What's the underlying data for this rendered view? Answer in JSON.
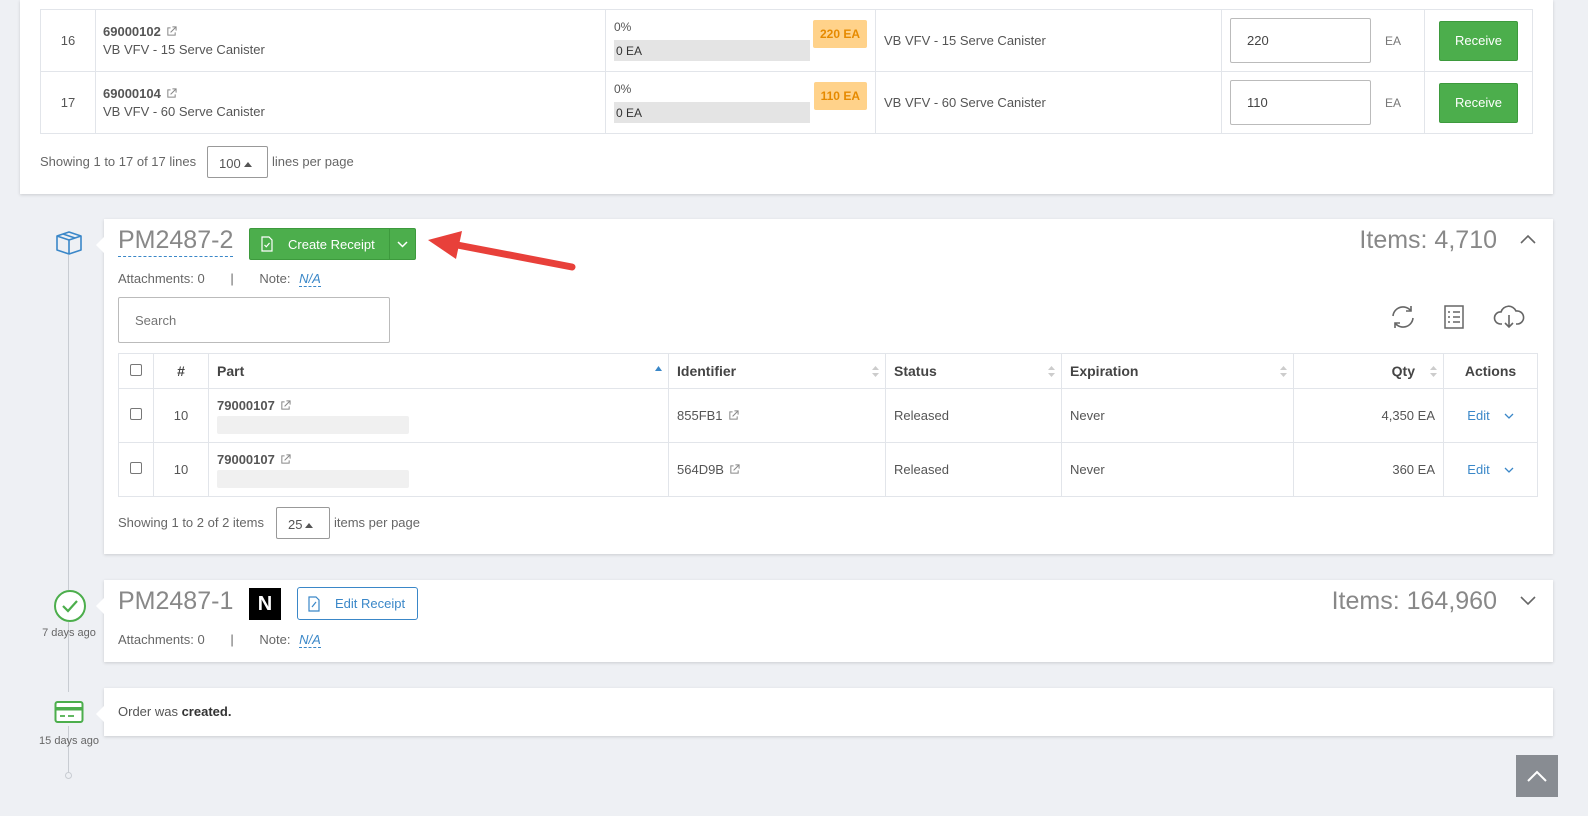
{
  "top_table": {
    "rows": [
      {
        "num": "16",
        "part_no": "69000102",
        "part_desc": "VB VFV - 15 Serve Canister",
        "pct": "0%",
        "received": "0 EA",
        "badge": "220 EA",
        "desc": "VB VFV - 15 Serve Canister",
        "qty": "220",
        "unit": "EA",
        "action": "Receive"
      },
      {
        "num": "17",
        "part_no": "69000104",
        "part_desc": "VB VFV - 60 Serve Canister",
        "pct": "0%",
        "received": "0 EA",
        "badge": "110 EA",
        "desc": "VB VFV - 60 Serve Canister",
        "qty": "110",
        "unit": "EA",
        "action": "Receive"
      }
    ],
    "showing": "Showing 1 to 17 of 17 lines",
    "per_page": "100",
    "per_page_suffix": "lines per page"
  },
  "shipment_open": {
    "title": "PM2487-2",
    "create_receipt_label": "Create Receipt",
    "items_total": "Items: 4,710",
    "attachments": "Attachments: 0",
    "separator": "|",
    "note_label": "Note:",
    "note_value": "N/A",
    "search_placeholder": "Search",
    "columns": {
      "num": "#",
      "part": "Part",
      "identifier": "Identifier",
      "status": "Status",
      "expiration": "Expiration",
      "qty": "Qty",
      "actions": "Actions"
    },
    "rows": [
      {
        "num": "10",
        "part_no": "79000107",
        "identifier": "855FB1",
        "status": "Released",
        "expiration": "Never",
        "qty": "4,350 EA",
        "action": "Edit"
      },
      {
        "num": "10",
        "part_no": "79000107",
        "identifier": "564D9B",
        "status": "Released",
        "expiration": "Never",
        "qty": "360 EA",
        "action": "Edit"
      }
    ],
    "showing": "Showing 1 to 2 of 2 items",
    "per_page": "25",
    "per_page_suffix": "items per page"
  },
  "shipment_received": {
    "title": "PM2487-1",
    "badge": "N",
    "edit_receipt_label": "Edit Receipt",
    "items_total": "Items: 164,960",
    "attachments": "Attachments: 0",
    "separator": "|",
    "note_label": "Note:",
    "note_value": "N/A",
    "time_ago": "7 days ago"
  },
  "order_created": {
    "text_prefix": "Order was ",
    "text_bold": "created.",
    "time_ago": "15 days ago"
  },
  "colors": {
    "green": "#4cae4c",
    "blue": "#3a87c8",
    "badge_bg": "#ffd28a",
    "badge_text": "#e68a00",
    "arrow": "#e8403a"
  }
}
